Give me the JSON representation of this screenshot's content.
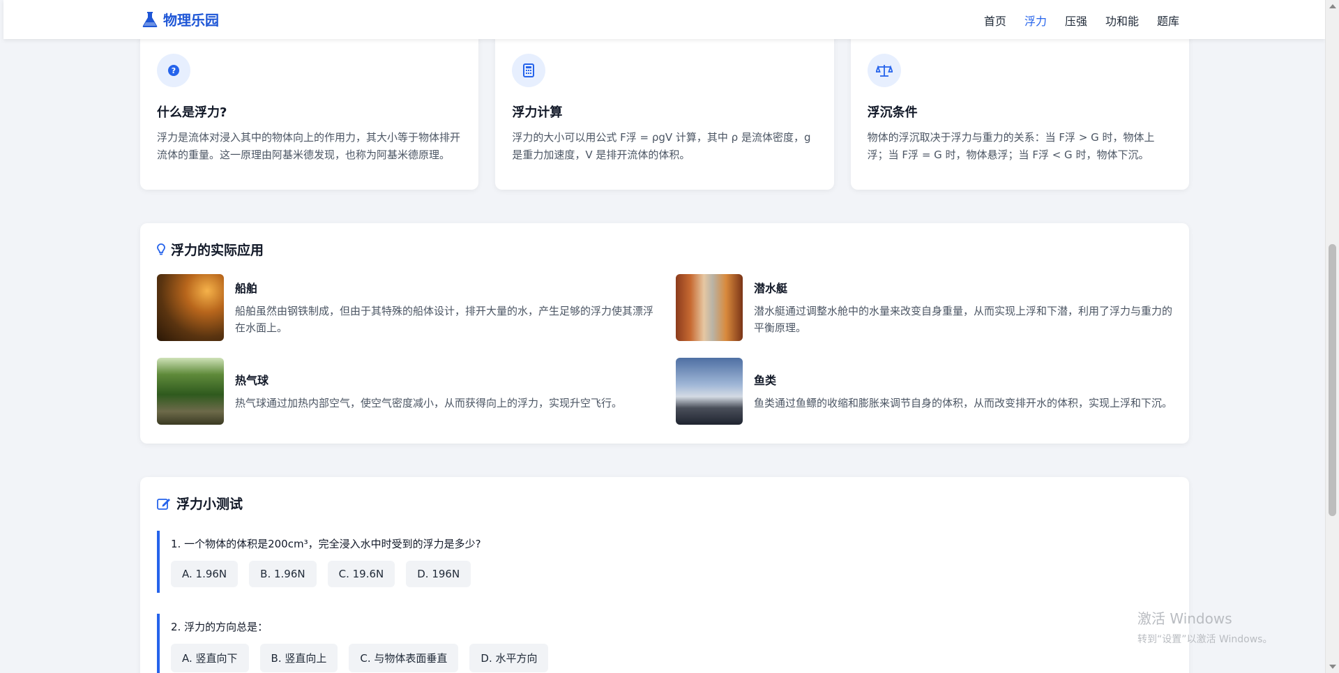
{
  "header": {
    "brand": "物理乐园",
    "nav": [
      "首页",
      "浮力",
      "压强",
      "功和能",
      "题库"
    ],
    "active": "浮力"
  },
  "cards": [
    {
      "icon": "question-circle-icon",
      "title": "什么是浮力?",
      "text": "浮力是流体对浸入其中的物体向上的作用力，其大小等于物体排开流体的重量。这一原理由阿基米德发现，也称为阿基米德原理。"
    },
    {
      "icon": "calculator-icon",
      "title": "浮力计算",
      "text": "浮力的大小可以用公式 F浮 = ρgV 计算，其中 ρ 是流体密度，g 是重力加速度，V 是排开流体的体积。"
    },
    {
      "icon": "balance-scale-icon",
      "title": "浮沉条件",
      "text": "物体的浮沉取决于浮力与重力的关系：当 F浮 > G 时，物体上浮；当 F浮 = G 时，物体悬浮；当 F浮 < G 时，物体下沉。"
    }
  ],
  "applications": {
    "title": "浮力的实际应用",
    "items": [
      {
        "title": "船舶",
        "text": "船舶虽然由钢铁制成，但由于其特殊的船体设计，排开大量的水，产生足够的浮力使其漂浮在水面上。"
      },
      {
        "title": "潜水艇",
        "text": "潜水艇通过调整水舱中的水量来改变自身重量，从而实现上浮和下潜，利用了浮力与重力的平衡原理。"
      },
      {
        "title": "热气球",
        "text": "热气球通过加热内部空气，使空气密度减小，从而获得向上的浮力，实现升空飞行。"
      },
      {
        "title": "鱼类",
        "text": "鱼类通过鱼鳔的收缩和膨胀来调节自身的体积，从而改变排开水的体积，实现上浮和下沉。"
      }
    ]
  },
  "quiz": {
    "title": "浮力小测试",
    "questions": [
      {
        "text": "1. 一个物体的体积是200cm³，完全浸入水中时受到的浮力是多少?",
        "options": [
          "A. 1.96N",
          "B. 1.96N",
          "C. 19.6N",
          "D. 196N"
        ]
      },
      {
        "text": "2. 浮力的方向总是：",
        "options": [
          "A. 竖直向下",
          "B. 竖直向上",
          "C. 与物体表面垂直",
          "D. 水平方向"
        ]
      }
    ]
  },
  "watermark": {
    "line1": "激活 Windows",
    "line2": "转到“设置”以激活 Windows。"
  },
  "colors": {
    "accent": "#2563eb",
    "brand": "#1e56d6",
    "background": "#f2f4f8"
  }
}
